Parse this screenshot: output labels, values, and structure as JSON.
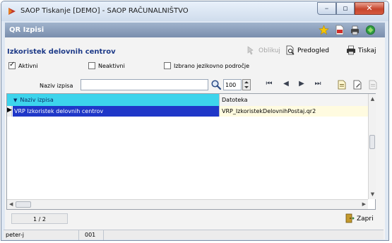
{
  "window": {
    "title": "SAOP Tiskanje [DEMO] - SAOP RAČUNALNIŠTVO",
    "controls": {
      "minimize": "–",
      "maximize": "▫",
      "close": "✕"
    }
  },
  "header": {
    "title": "QR Izpisi",
    "icons": [
      "star-icon",
      "pdf-icon",
      "printer-settings-icon",
      "help-icon"
    ]
  },
  "form": {
    "title": "Izkoristek delovnih centrov",
    "actions": {
      "design": "Oblikuj",
      "preview": "Predogled",
      "print": "Tiskaj"
    },
    "checkboxes": [
      {
        "label": "Aktivni",
        "checked": true
      },
      {
        "label": "Neaktivni",
        "checked": false
      },
      {
        "label": "Izbrano jezikovno področje",
        "checked": false
      }
    ]
  },
  "search": {
    "label": "Naziv izpisa",
    "value": "",
    "zoom": "100"
  },
  "nav": {
    "first": "⏮",
    "prev": "◀",
    "next": "▶",
    "last": "⏭"
  },
  "grid": {
    "columns": [
      "Naziv izpisa",
      "Datoteka"
    ],
    "rows": [
      {
        "name": "VRP Izkoristek delovnih centrov",
        "file": "VRP_IzkoristekDelovnihPostaj.qr2"
      }
    ]
  },
  "pager": {
    "text": "1 / 2"
  },
  "close_button": {
    "label": "Zapri"
  },
  "status": {
    "user": "peter-j",
    "code": "001",
    "extra": ""
  },
  "colors": {
    "header_band": "#8ea1bd",
    "column_header_active": "#3dd4ec",
    "row_selected": "#1f37c8",
    "row_file_bg": "#fffbe0",
    "form_title": "#1d3a88"
  }
}
